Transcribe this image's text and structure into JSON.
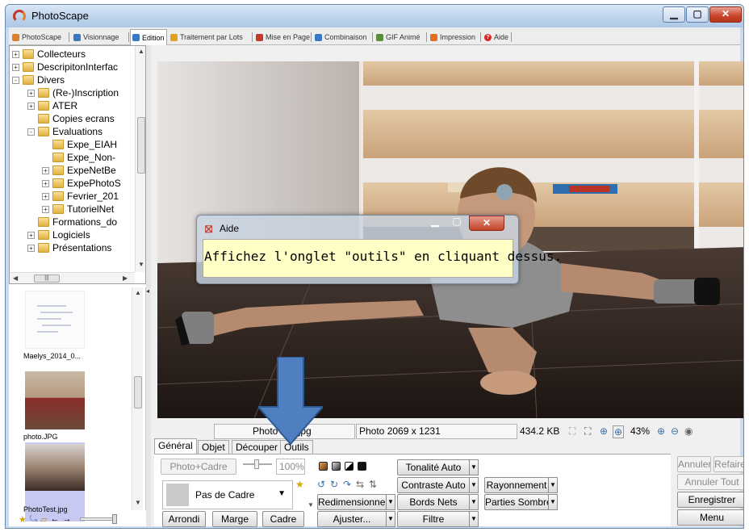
{
  "window": {
    "title": "PhotoScape"
  },
  "main_tabs": [
    {
      "label": "PhotoScape",
      "color": "#d9822b"
    },
    {
      "label": "Visionnage",
      "color": "#3a78c2"
    },
    {
      "label": "Edition",
      "color": "#3a78c2",
      "active": true
    },
    {
      "label": "Traitement par Lots",
      "color": "#e0a020"
    },
    {
      "label": "Mise en Page",
      "color": "#c0392b"
    },
    {
      "label": "Combinaison",
      "color": "#3a78c2"
    },
    {
      "label": "GIF Animé",
      "color": "#5a8c3a"
    },
    {
      "label": "Impression",
      "color": "#e07020"
    },
    {
      "label": "Aide",
      "color": "#d22222"
    }
  ],
  "tree": [
    {
      "label": "Collecteurs",
      "depth": 0,
      "expander": "+"
    },
    {
      "label": "DescripitonInterfac",
      "depth": 0,
      "expander": "+"
    },
    {
      "label": "Divers",
      "depth": 0,
      "expander": "-"
    },
    {
      "label": "(Re-)Inscription",
      "depth": 1,
      "expander": "+"
    },
    {
      "label": "ATER",
      "depth": 1,
      "expander": "+"
    },
    {
      "label": "Copies ecrans",
      "depth": 1,
      "expander": ""
    },
    {
      "label": "Evaluations",
      "depth": 1,
      "expander": "-"
    },
    {
      "label": "Expe_EIAH",
      "depth": 2,
      "expander": ""
    },
    {
      "label": "Expe_Non-",
      "depth": 2,
      "expander": ""
    },
    {
      "label": "ExpeNetBe",
      "depth": 2,
      "expander": "+"
    },
    {
      "label": "ExpePhotoS",
      "depth": 2,
      "expander": "+"
    },
    {
      "label": "Fevrier_201",
      "depth": 2,
      "expander": "+"
    },
    {
      "label": "TutorielNet",
      "depth": 2,
      "expander": "+"
    },
    {
      "label": "Formations_do",
      "depth": 1,
      "expander": ""
    },
    {
      "label": "Logiciels",
      "depth": 1,
      "expander": "+"
    },
    {
      "label": "Présentations",
      "depth": 1,
      "expander": "+"
    }
  ],
  "thumbnails": [
    {
      "caption": "Maelys_2014_0..."
    },
    {
      "caption": "photo.JPG"
    },
    {
      "caption": "PhotoTest.jpg"
    }
  ],
  "info": {
    "filename": "PhotoTest.jpg",
    "dimensions": "Photo 2069 x 1231",
    "filesize": "434.2 KB",
    "zoom": "43%"
  },
  "aide_dialog": {
    "title": "Aide",
    "message": "Affichez l'onglet \"outils\" en cliquant dessus."
  },
  "bottom_tabs": [
    "Général",
    "Objet",
    "Découper",
    "Outils"
  ],
  "general_panel": {
    "photo_frame_button": "Photo+Cadre",
    "opacity_value": "100%",
    "frame_select_value": "Pas de Cadre",
    "round_button": "Arrondi",
    "margin_button": "Marge",
    "frame_button": "Cadre",
    "auto_tone_button": "Tonalité Auto",
    "auto_contrast_button": "Contraste Auto",
    "glow_button": "Rayonnement",
    "resize_button": "Redimensionner",
    "sharpen_button": "Bords Nets",
    "dark_parts_button": "Parties Sombres",
    "adjust_button": "Ajuster...",
    "filter_button": "Filtre"
  },
  "right_buttons": {
    "undo": "Annuler",
    "redo": "Refaire",
    "undo_all": "Annuler Tout",
    "save": "Enregistrer",
    "menu": "Menu"
  }
}
